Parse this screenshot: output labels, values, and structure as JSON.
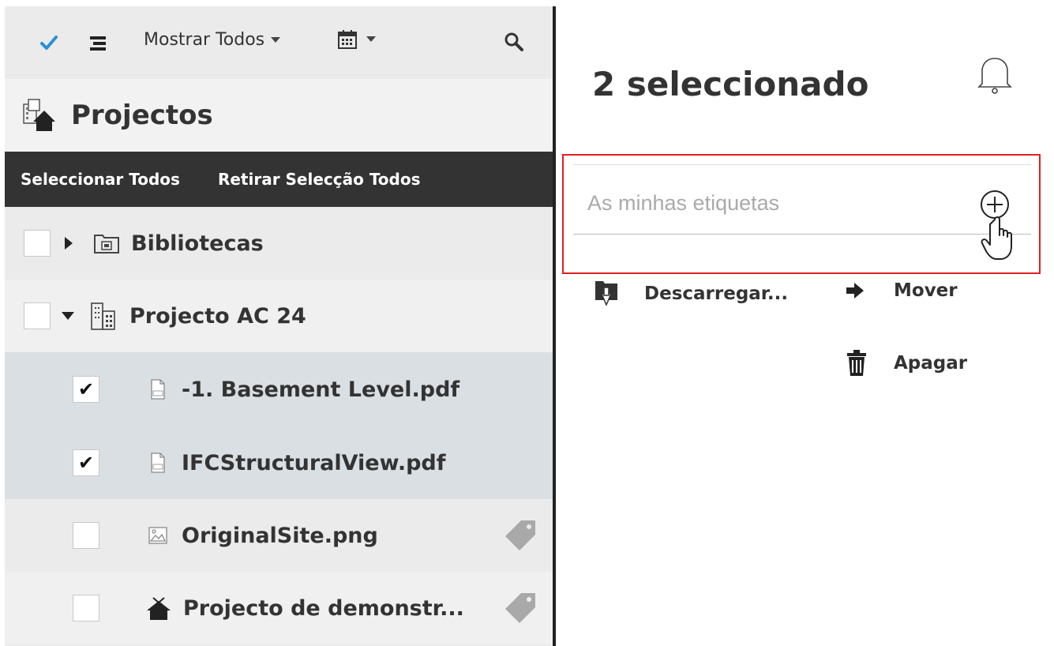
{
  "toolbar": {
    "filter_label": "Mostrar Todos"
  },
  "projects": {
    "title": "Projectos"
  },
  "selection_bar": {
    "select_all": "Seleccionar Todos",
    "deselect_all": "Retirar Selecção Todos"
  },
  "tree": [
    {
      "label": "Bibliotecas",
      "checked": false
    },
    {
      "label": "Projecto AC 24",
      "checked": false
    },
    {
      "label": "-1. Basement Level.pdf",
      "checked": true
    },
    {
      "label": "IFCStructuralView.pdf",
      "checked": true
    },
    {
      "label": "OriginalSite.png",
      "checked": false
    },
    {
      "label": "Projecto de demonstr...",
      "checked": false
    }
  ],
  "panel": {
    "title": "2 seleccionado",
    "tags_placeholder": "As minhas etiquetas"
  },
  "actions": {
    "download": "Descarregar...",
    "move": "Mover",
    "delete": "Apagar"
  },
  "colors": {
    "accent_check": "#2a8fd6",
    "highlight_box": "#e02020",
    "selected_row": "#dadfe3"
  }
}
